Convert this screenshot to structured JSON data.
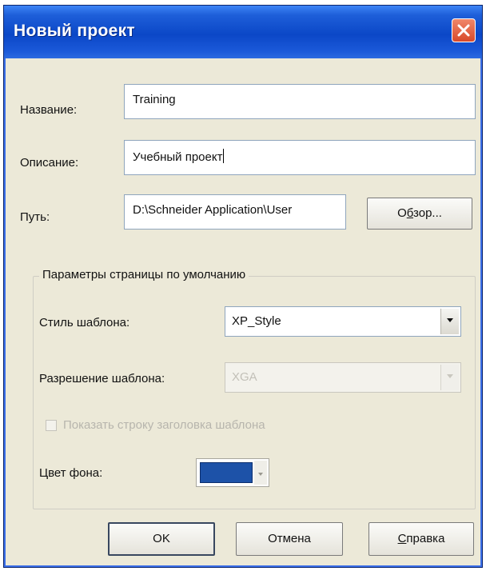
{
  "window": {
    "title": "Новый проект"
  },
  "fields": {
    "name_label": "Название:",
    "name_value": "Training",
    "description_label": "Описание:",
    "description_value": "Учебный проект",
    "path_label": "Путь:",
    "path_value": "D:\\Schneider Application\\User",
    "browse_button_pre": "О",
    "browse_button_acc": "б",
    "browse_button_post": "зор..."
  },
  "page_defaults": {
    "group_title": "Параметры страницы по умолчанию",
    "template_style_label": "Стиль шаблона:",
    "template_style_value": "XP_Style",
    "template_resolution_label": "Разрешение шаблона:",
    "template_resolution_value": "XGA",
    "show_title_bar_label": "Показать строку заголовка шаблона",
    "show_title_bar_checked": false,
    "bg_color_label": "Цвет фона:",
    "bg_color": "#1d52a8"
  },
  "buttons": {
    "ok": "OK",
    "cancel": "Отмена",
    "help_acc": "С",
    "help_post": "правка"
  }
}
